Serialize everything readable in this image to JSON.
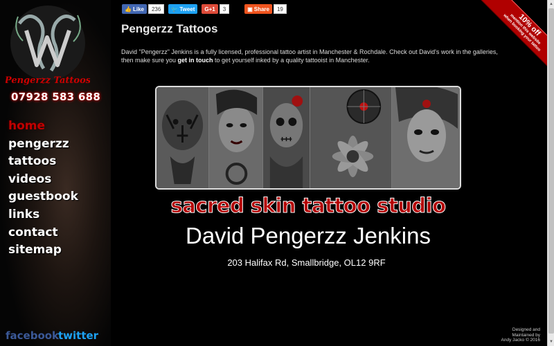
{
  "sidebar": {
    "logo_text": "Pengerzz Tattoos",
    "phone": "07928 583 688",
    "nav": [
      {
        "label": "home",
        "active": true
      },
      {
        "label": "pengerzz",
        "active": false
      },
      {
        "label": "tattoos",
        "active": false
      },
      {
        "label": "videos",
        "active": false
      },
      {
        "label": "guestbook",
        "active": false
      },
      {
        "label": "links",
        "active": false
      },
      {
        "label": "contact",
        "active": false
      },
      {
        "label": "sitemap",
        "active": false
      }
    ],
    "facebook": "facebook",
    "twitter": "twitter"
  },
  "social": {
    "like_label": "Like",
    "like_count": "236",
    "tweet_label": "Tweet",
    "gplus_label": "G+1",
    "gplus_count": "3",
    "share_label": "Share",
    "share_count": "19"
  },
  "main": {
    "title": "Pengerzz Tattoos",
    "intro_1": "David \"Pengerzz\" Jenkins is a fully licensed, professional tattoo artist in Manchester & Rochdale. Check out David's work in the galleries, then make sure you ",
    "intro_link": "get in touch",
    "intro_2": " to get yourself inked by a quality tattooist in Manchester.",
    "studio": "sacred skin tattoo studio",
    "artist": "David Pengerzz Jenkins",
    "address": "203 Halifax Rd, Smallbridge, OL12 9RF"
  },
  "ribbon": {
    "big": "10% off",
    "line2": "mention this website",
    "line3": "when booking your tattoo"
  },
  "credit": {
    "line1": "Designed and",
    "line2": "Maintained by",
    "line3": "Andy Jacko © 2016"
  },
  "colors": {
    "accent_red": "#b40000",
    "facebook_blue": "#3b5998",
    "twitter_blue": "#1da1f2"
  }
}
